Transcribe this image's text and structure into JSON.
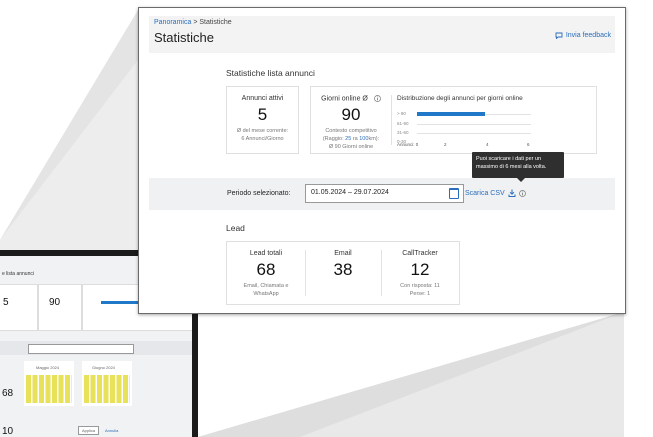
{
  "breadcrumb": {
    "parent": "Panoramica",
    "separator": ">",
    "current": "Statistiche"
  },
  "page_title": "Statistiche",
  "feedback": {
    "label": "Invia feedback",
    "icon": "comment-icon"
  },
  "listings": {
    "section_title": "Statistiche lista annunci",
    "active": {
      "label": "Annunci attivi",
      "value": "5",
      "note1": "Ø del mese corrente:",
      "note2": "6 Annunci/Giorno"
    },
    "online_days": {
      "label": "Giorni online Ø",
      "info_icon": "info-icon",
      "value": "90",
      "note1": "Contesto competitivo",
      "note2_prefix": "(Raggio:",
      "note2_v1": "25",
      "note2_mid": "ra",
      "note2_v2": "100",
      "note2_suffix": "km):",
      "note3": "Ø 90 Giorni online"
    },
    "distribution": {
      "title": "Distribuzione degli annunci per giorni online",
      "rows": [
        {
          "label": "> 90",
          "value": 0.6
        },
        {
          "label": "61-90",
          "value": 0
        },
        {
          "label": "31-60",
          "value": 0
        },
        {
          "label": "0-30",
          "value": 0
        }
      ],
      "footer": [
        "Annunci: 0",
        "2",
        "4",
        "6"
      ]
    }
  },
  "period": {
    "label": "Periodo selezionato:",
    "value": "01.05.2024 – 29.07.2024",
    "calendar_icon": "calendar-icon",
    "csv_label": "Scarica CSV",
    "download_icon": "download-icon",
    "info_icon": "info-icon"
  },
  "tooltip": {
    "line1": "Puoi scaricare i dati per un",
    "line2": "massimo di 6 mesi alla volta."
  },
  "lead": {
    "section_title": "Lead",
    "total": {
      "label": "Lead totali",
      "value": "68",
      "note1": "Email, Chiamata e",
      "note2": "WhatsApp"
    },
    "email": {
      "label": "Email",
      "value": "38"
    },
    "calltracker": {
      "label": "CallTracker",
      "value": "12",
      "note1": "Con risposta: 11",
      "note2": "Perse: 1"
    }
  },
  "background_laptop": {
    "title": "e lista annunci",
    "card1_value": "5",
    "card2_value": "90",
    "lead_value": "68",
    "bottom_value": "10",
    "months": [
      "Maggio 2024",
      "Giugno 2024"
    ],
    "apply_label": "Applica",
    "cancel_label": "Annulla"
  },
  "colors": {
    "accent": "#2a6ebb",
    "bar": "#1f78c8",
    "tooltip_bg": "#2f2f2f",
    "highlight": "#e8e25a"
  }
}
